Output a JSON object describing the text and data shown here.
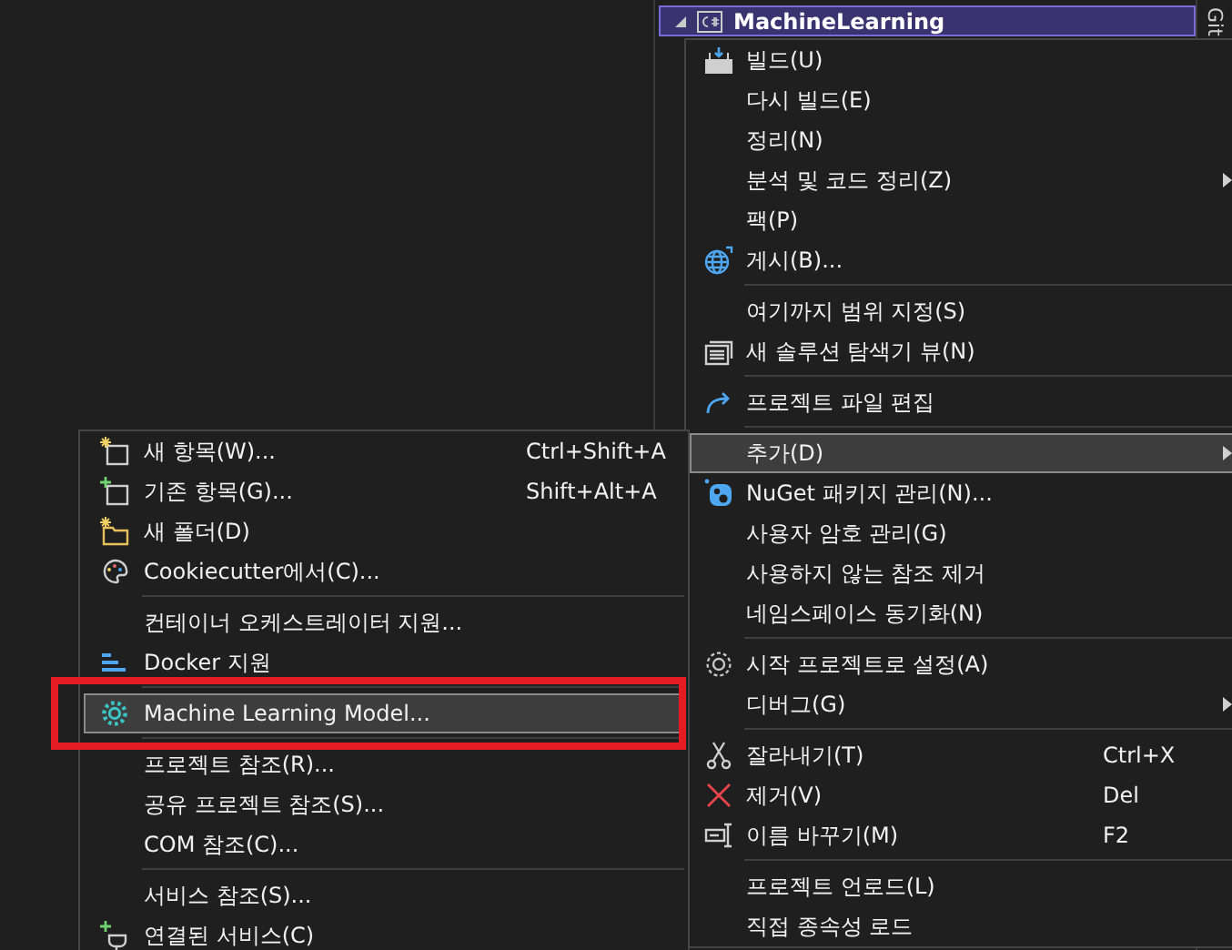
{
  "solution_explorer": {
    "project": {
      "label": "MachineLearning",
      "selected": true
    },
    "side_tab": "Git"
  },
  "context_menu": {
    "items": [
      {
        "kind": "item",
        "label": "빌드(U)",
        "selected": false
      },
      {
        "kind": "item",
        "label": "다시 빌드(E)",
        "selected": false
      },
      {
        "kind": "item",
        "label": "정리(N)",
        "selected": false
      },
      {
        "kind": "item",
        "label": "분석 및 코드 정리(Z)",
        "submenu": true,
        "selected": false
      },
      {
        "kind": "item",
        "label": "팩(P)",
        "selected": false
      },
      {
        "kind": "item",
        "label": "게시(B)...",
        "selected": false
      },
      {
        "kind": "separator"
      },
      {
        "kind": "item",
        "label": "여기까지 범위 지정(S)",
        "selected": false
      },
      {
        "kind": "item",
        "label": "새 솔루션 탐색기 뷰(N)",
        "selected": false
      },
      {
        "kind": "separator"
      },
      {
        "kind": "item",
        "label": "프로젝트 파일 편집",
        "selected": false
      },
      {
        "kind": "separator"
      },
      {
        "kind": "item",
        "label": "추가(D)",
        "submenu": true,
        "selected": true
      },
      {
        "kind": "item",
        "label": "NuGet 패키지 관리(N)...",
        "selected": false
      },
      {
        "kind": "item",
        "label": "사용자 암호 관리(G)",
        "selected": false
      },
      {
        "kind": "item",
        "label": "사용하지 않는 참조 제거",
        "selected": false
      },
      {
        "kind": "item",
        "label": "네임스페이스 동기화(N)",
        "selected": false
      },
      {
        "kind": "separator"
      },
      {
        "kind": "item",
        "label": "시작 프로젝트로 설정(A)",
        "selected": false
      },
      {
        "kind": "item",
        "label": "디버그(G)",
        "submenu": true,
        "selected": false
      },
      {
        "kind": "separator"
      },
      {
        "kind": "item",
        "label": "잘라내기(T)",
        "shortcut": "Ctrl+X",
        "selected": false
      },
      {
        "kind": "item",
        "label": "제거(V)",
        "shortcut": "Del",
        "selected": false
      },
      {
        "kind": "item",
        "label": "이름 바꾸기(M)",
        "shortcut": "F2",
        "selected": false
      },
      {
        "kind": "separator"
      },
      {
        "kind": "item",
        "label": "프로젝트 언로드(L)",
        "selected": false
      },
      {
        "kind": "item",
        "label": "직접 종속성 로드",
        "selected": false
      }
    ]
  },
  "add_submenu": {
    "items": [
      {
        "kind": "item",
        "label": "새 항목(W)...",
        "shortcut": "Ctrl+Shift+A",
        "selected": false
      },
      {
        "kind": "item",
        "label": "기존 항목(G)...",
        "shortcut": "Shift+Alt+A",
        "selected": false
      },
      {
        "kind": "item",
        "label": "새 폴더(D)",
        "selected": false
      },
      {
        "kind": "item",
        "label": "Cookiecutter에서(C)...",
        "selected": false
      },
      {
        "kind": "separator"
      },
      {
        "kind": "item",
        "label": "컨테이너 오케스트레이터 지원...",
        "selected": false
      },
      {
        "kind": "item",
        "label": "Docker 지원",
        "selected": false
      },
      {
        "kind": "separator"
      },
      {
        "kind": "item",
        "label": "Machine Learning Model...",
        "selected": true,
        "annotated": true
      },
      {
        "kind": "separator"
      },
      {
        "kind": "item",
        "label": "프로젝트 참조(R)...",
        "selected": false
      },
      {
        "kind": "item",
        "label": "공유 프로젝트 참조(S)...",
        "selected": false
      },
      {
        "kind": "item",
        "label": "COM 참조(C)...",
        "selected": false
      },
      {
        "kind": "separator"
      },
      {
        "kind": "item",
        "label": "서비스 참조(S)...",
        "selected": false
      },
      {
        "kind": "item",
        "label": "연결된 서비스(C)",
        "selected": false
      }
    ]
  }
}
